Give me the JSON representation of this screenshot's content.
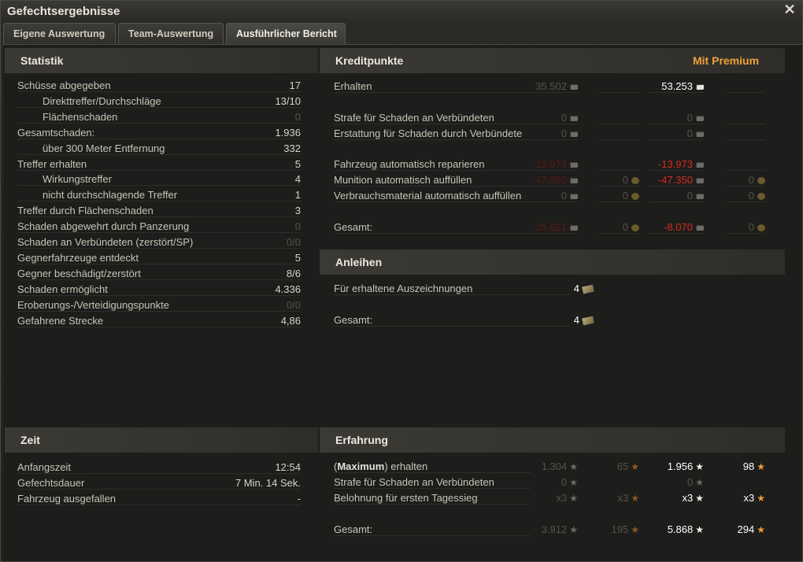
{
  "window": {
    "title": "Gefechtsergebnisse",
    "close_icon": "close-icon"
  },
  "tabs": [
    {
      "label": "Eigene Auswertung",
      "active": false
    },
    {
      "label": "Team-Auswertung",
      "active": false
    },
    {
      "label": "Ausführlicher Bericht",
      "active": true
    }
  ],
  "statistik": {
    "title": "Statistik",
    "rows": [
      {
        "label": "Schüsse abgegeben",
        "value": "17"
      },
      {
        "label": "Direkttreffer/Durchschläge",
        "value": "13/10"
      },
      {
        "label": "Flächenschaden",
        "value": "0"
      },
      {
        "label": "Gesamtschaden:",
        "value": "1.936"
      },
      {
        "label": "über 300 Meter Entfernung",
        "value": "332"
      },
      {
        "label": "Treffer erhalten",
        "value": "5"
      },
      {
        "label": "Wirkungstreffer",
        "value": "4"
      },
      {
        "label": "nicht durchschlagende Treffer",
        "value": "1"
      },
      {
        "label": "Treffer durch Flächenschaden",
        "value": "3"
      },
      {
        "label": "Schaden abgewehrt durch Panzerung",
        "value": "0"
      },
      {
        "label": "Schaden an Verbündeten (zerstört/SP)",
        "value": "0/0"
      },
      {
        "label": "Gegnerfahrzeuge entdeckt",
        "value": "5"
      },
      {
        "label": "Gegner beschädigt/zerstört",
        "value": "8/6"
      },
      {
        "label": "Schaden ermöglicht",
        "value": "4.336"
      },
      {
        "label": "Eroberungs-/Verteidigungspunkte",
        "value": "0/0"
      },
      {
        "label": "Gefahrene Strecke",
        "value": "4,86"
      }
    ]
  },
  "zeit": {
    "title": "Zeit",
    "rows": [
      {
        "label": "Anfangszeit",
        "value": "12:54"
      },
      {
        "label": "Gefechtsdauer",
        "value": "7 Min. 14 Sek."
      },
      {
        "label": "Fahrzeug ausgefallen",
        "value": "-"
      }
    ]
  },
  "kreditpunkte": {
    "title": "Kreditpunkte",
    "premium_label": "Mit Premium",
    "rows": [
      {
        "label": "Erhalten",
        "credits": "35.502",
        "gold": "",
        "premium_credits": "53.253",
        "premium_gold": ""
      },
      {
        "label": "Strafe für Schaden an Verbündeten",
        "credits": "0",
        "gold": "",
        "premium_credits": "0",
        "premium_gold": ""
      },
      {
        "label": "Erstattung für Schaden durch Verbündete",
        "credits": "0",
        "gold": "",
        "premium_credits": "0",
        "premium_gold": ""
      },
      {
        "label": "Fahrzeug automatisch reparieren",
        "credits": "-13.973",
        "gold": "",
        "premium_credits": "-13.973",
        "premium_gold": ""
      },
      {
        "label": "Munition automatisch auffüllen",
        "credits": "-47.350",
        "gold": "0",
        "premium_credits": "-47.350",
        "premium_gold": "0"
      },
      {
        "label": "Verbrauchsmaterial automatisch auffüllen",
        "credits": "0",
        "gold": "0",
        "premium_credits": "0",
        "premium_gold": "0"
      },
      {
        "label": "Gesamt:",
        "credits": "-25.821",
        "gold": "0",
        "premium_credits": "-8.070",
        "premium_gold": "0"
      }
    ]
  },
  "anleihen": {
    "title": "Anleihen",
    "rows": [
      {
        "label": "Für erhaltene Auszeichnungen",
        "value": "4"
      },
      {
        "label": "Gesamt:",
        "value": "4"
      }
    ]
  },
  "erfahrung": {
    "title": "Erfahrung",
    "rows": [
      {
        "label_pre": "(",
        "label_bold": "Maximum",
        "label_post": ") erhalten",
        "xp": "1.304",
        "free_xp": "65",
        "premium_xp": "1.956",
        "premium_free_xp": "98"
      },
      {
        "label": "Strafe für Schaden an Verbündeten",
        "xp": "0",
        "free_xp": "",
        "premium_xp": "0",
        "premium_free_xp": ""
      },
      {
        "label": "Belohnung für ersten Tagessieg",
        "xp": "x3",
        "free_xp": "x3",
        "premium_xp": "x3",
        "premium_free_xp": "x3"
      },
      {
        "label": "Gesamt:",
        "xp": "3.912",
        "free_xp": "195",
        "premium_xp": "5.868",
        "premium_free_xp": "294"
      }
    ]
  },
  "colors": {
    "premium": "#f09a3a",
    "negative": "#d42b1e",
    "background": "#1d1d1b"
  }
}
